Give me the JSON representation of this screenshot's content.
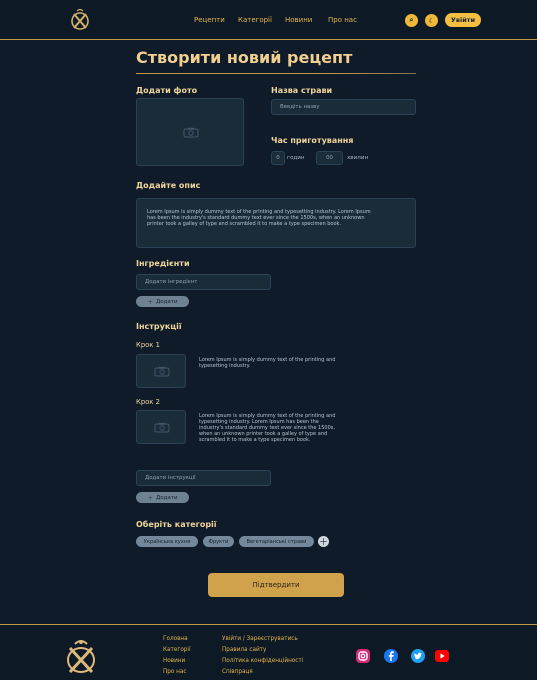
{
  "header": {
    "nav": [
      "Рецепти",
      "Категорії",
      "Новини",
      "Про нас"
    ],
    "login": "Увійти"
  },
  "page": {
    "title": "Створити новий рецепт",
    "add_photo": "Додати фото",
    "dish_name_label": "Назва страви",
    "dish_name_placeholder": "Введіть назву",
    "cook_time_label": "Час приготування",
    "hours_value": "0",
    "hours_label": "годин",
    "minutes_value": "00",
    "minutes_label": "хвилин",
    "description_label": "Додайте опис",
    "description_text": "Lorem Ipsum is simply dummy text of the printing and typesetting industry. Lorem Ipsum has been the industry's standard dummy text ever since the 1500s, when an unknown printer took a galley of type and scrambled it to make a type specimen book.",
    "ingredients_label": "Інгредієнти",
    "ingredient_placeholder": "Додати інгредієнт",
    "add_button": "Додати",
    "instructions_label": "Інструкції",
    "steps": [
      {
        "label": "Крок 1",
        "text": "Lorem Ipsum is simply dummy text of the printing and typesetting industry."
      },
      {
        "label": "Крок 2",
        "text": "Lorem Ipsum is simply dummy text of the printing and typesetting industry. Lorem Ipsum has been the industry's standard dummy text ever since the 1500s, when an unknown printer took a galley of type and scrambled it to make a type specimen book."
      }
    ],
    "instruction_placeholder": "Додати інструкції",
    "categories_label": "Оберіть категорії",
    "categories": [
      "Українська кухня",
      "Фрукти",
      "Вегетаріанські страви"
    ],
    "submit": "Підтвердити"
  },
  "footer": {
    "col1": [
      "Головна",
      "Категорії",
      "Новини",
      "Про нас"
    ],
    "col2": [
      "Увійти / Зареєструватись",
      "Правила сайту",
      "Політика конфіденційності",
      "Співпраця"
    ]
  }
}
